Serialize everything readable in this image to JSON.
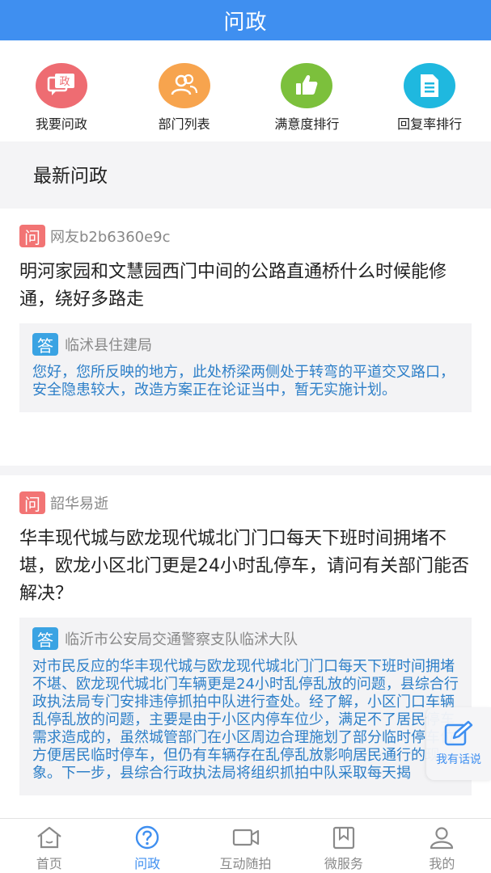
{
  "header": {
    "title": "问政"
  },
  "quick_actions": [
    {
      "label": "我要问政",
      "icon": "ask-icon",
      "color": "#ee6c72",
      "glyph": "政"
    },
    {
      "label": "部门列表",
      "icon": "people-icon",
      "color": "#f7a44e"
    },
    {
      "label": "满意度排行",
      "icon": "thumbs-up-icon",
      "color": "#7cc03c"
    },
    {
      "label": "回复率排行",
      "icon": "document-icon",
      "color": "#1fb8df"
    }
  ],
  "section": {
    "title": "最新问政"
  },
  "posts": [
    {
      "q_badge": "问",
      "asker": "网友b2b6360e9c",
      "question": "明河家园和文慧园西门中间的公路直通桥什么时候能修通，绕好多路走",
      "a_badge": "答",
      "department": "临沭县住建局",
      "answer": "您好，您所反映的地方，此处桥梁两侧处于转弯的平道交叉路口，安全隐患较大，改造方案正在论证当中，暂无实施计划。"
    },
    {
      "q_badge": "问",
      "asker": "韶华易逝",
      "question": "华丰现代城与欧龙现代城北门门口每天下班时间拥堵不堪，欧龙小区北门更是24小时乱停车，请问有关部门能否解决？",
      "a_badge": "答",
      "department": "临沂市公安局交通警察支队临沭大队",
      "answer": "对市民反应的华丰现代城与欧龙现代城北门门口每天下班时间拥堵不堪、欧龙现代城北门车辆更是24小时乱停乱放的问题，县综合行政执法局专门安排违停抓拍中队进行查处。经了解，小区门口车辆乱停乱放的问题，主要是由于小区内停车位少，满足不了居民停车需求造成的，虽然城管部门在小区周边合理施划了部分临时停车位方便居民临时停车，但仍有车辆存在乱停乱放影响居民通行的现象。下一步，县综合行政执法局将组织抓拍中队采取每天揭"
    }
  ],
  "float_button": {
    "label": "我有话说",
    "icon": "edit-icon"
  },
  "tabs": [
    {
      "label": "首页",
      "icon": "home-icon",
      "active": false
    },
    {
      "label": "问政",
      "icon": "question-icon",
      "active": true
    },
    {
      "label": "互动随拍",
      "icon": "camera-icon",
      "active": false
    },
    {
      "label": "微服务",
      "icon": "bookmark-icon",
      "active": false
    },
    {
      "label": "我的",
      "icon": "user-icon",
      "active": false
    }
  ],
  "colors": {
    "primary": "#3f8ff0",
    "answer_text": "#2d7fc8",
    "question_badge": "#f27474",
    "answer_badge": "#3aa3e3"
  }
}
